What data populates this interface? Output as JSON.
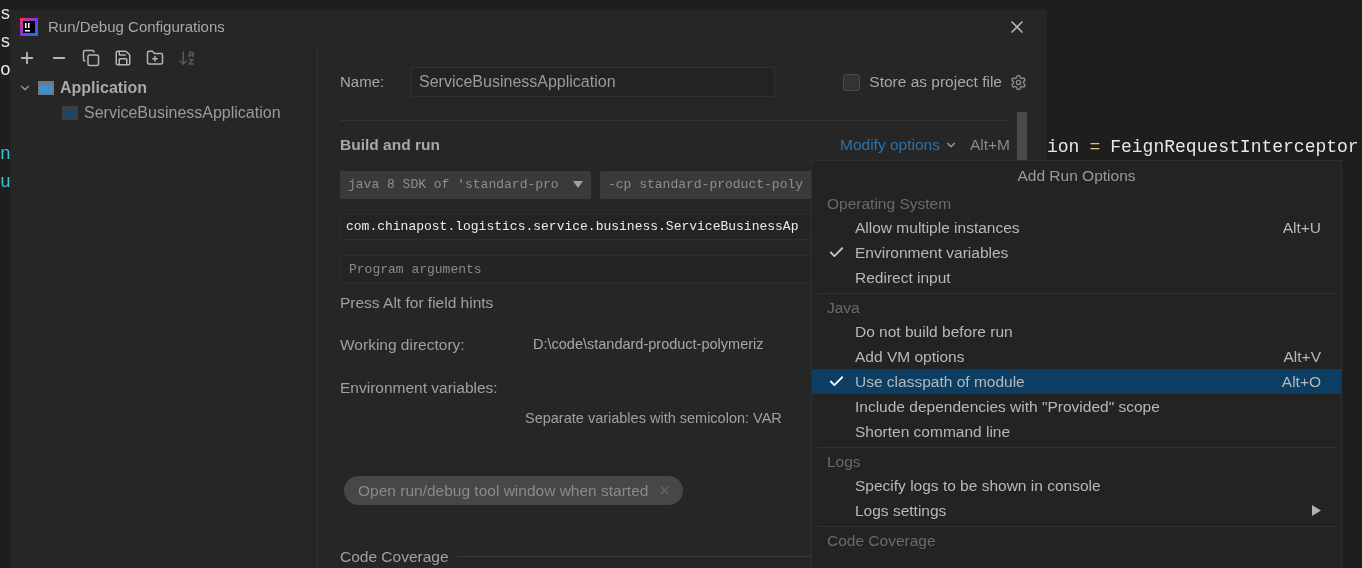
{
  "editor": {
    "left_lines": [
      {
        "kind": "text",
        "text": "s",
        "color": "#e8e8e8"
      },
      {
        "kind": "text",
        "text": "s",
        "color": "#e8e8e8"
      },
      {
        "kind": "text",
        "text": "o",
        "color": "#e8e8e8"
      },
      {
        "kind": "blank"
      },
      {
        "kind": "blank"
      },
      {
        "kind": "text",
        "text": "n",
        "color": "#3fc1d6"
      },
      {
        "kind": "text",
        "text": "u",
        "color": "#3fc1d6"
      }
    ],
    "right_tokens": [
      {
        "text": "ion",
        "color": "#e8e8e8"
      },
      {
        "text": "=",
        "color": "#e5c07b"
      },
      {
        "text": "FeignRequestInterceptor",
        "color": "#e8e8e8"
      }
    ]
  },
  "dialog": {
    "title": "Run/Debug Configurations",
    "tree": [
      {
        "label": "Application",
        "expanded": true,
        "children": [
          {
            "label": "ServiceBusinessApplication"
          }
        ]
      }
    ],
    "name": {
      "label": "Name:",
      "value": "ServiceBusinessApplication"
    },
    "store_as_project_file": {
      "label": "Store as project file",
      "checked": false
    },
    "build_and_run": {
      "title": "Build and run",
      "modify_options": "Modify options",
      "modify_shortcut": "Alt+M",
      "jre": "java 8 SDK of 'standard-pro",
      "classpath": "-cp standard-product-poly",
      "main_class": "com.chinapost.logistics.service.business.ServiceBusinessAp",
      "program_arguments_placeholder": "Program arguments"
    },
    "hint": "Press Alt for field hints",
    "working_directory": {
      "label": "Working directory:",
      "value": "D:\\code\\standard-product-polymeriz"
    },
    "environment_variables": {
      "label": "Environment variables:",
      "hint": "Separate variables with semicolon: VAR"
    },
    "chips": [
      {
        "label": "Open run/debug tool window when started"
      }
    ],
    "code_coverage": "Code Coverage"
  },
  "popup": {
    "title": "Add Run Options",
    "groups": [
      {
        "header": "Operating System",
        "items": [
          {
            "label": "Allow multiple instances",
            "shortcut": "Alt+U",
            "checked": false,
            "selected": false
          },
          {
            "label": "Environment variables",
            "checked": true,
            "selected": false
          },
          {
            "label": "Redirect input",
            "checked": false,
            "selected": false
          }
        ]
      },
      {
        "header": "Java",
        "items": [
          {
            "label": "Do not build before run",
            "checked": false,
            "selected": false
          },
          {
            "label": "Add VM options",
            "shortcut": "Alt+V",
            "checked": false,
            "selected": false
          },
          {
            "label": "Use classpath of module",
            "shortcut": "Alt+O",
            "checked": true,
            "selected": true
          },
          {
            "label": "Include dependencies with \"Provided\" scope",
            "checked": false,
            "selected": false
          },
          {
            "label": "Shorten command line",
            "checked": false,
            "selected": false
          }
        ]
      },
      {
        "header": "Logs",
        "items": [
          {
            "label": "Specify logs to be shown in console",
            "checked": false,
            "selected": false
          },
          {
            "label": "Logs settings",
            "checked": false,
            "selected": false,
            "submenu": true
          }
        ]
      },
      {
        "header": "Code Coverage"
      }
    ]
  }
}
